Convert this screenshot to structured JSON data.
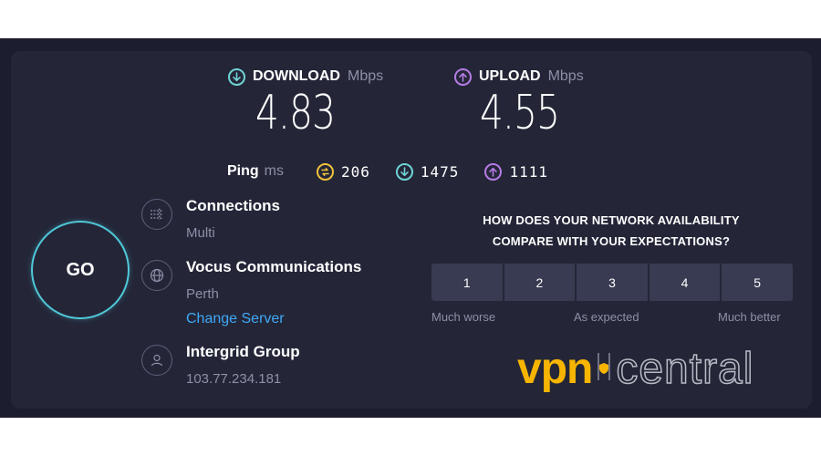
{
  "download": {
    "label": "DOWNLOAD",
    "unit": "Mbps",
    "value": "4.83",
    "icon": "arrow-down-circle-icon"
  },
  "upload": {
    "label": "UPLOAD",
    "unit": "Mbps",
    "value": "4.55",
    "icon": "arrow-up-circle-icon"
  },
  "ping": {
    "label": "Ping",
    "unit": "ms",
    "idle": "206",
    "download": "1475",
    "upload": "1111"
  },
  "go_label": "GO",
  "connections": {
    "title": "Connections",
    "value": "Multi"
  },
  "server": {
    "title": "Vocus Communications",
    "location": "Perth",
    "change_link": "Change Server"
  },
  "provider": {
    "title": "Intergrid Group",
    "ip": "103.77.234.181"
  },
  "survey": {
    "question_line1": "HOW DOES YOUR NETWORK AVAILABILITY",
    "question_line2": "COMPARE WITH YOUR EXPECTATIONS?",
    "options": [
      "1",
      "2",
      "3",
      "4",
      "5"
    ],
    "label_low": "Much worse",
    "label_mid": "As expected",
    "label_high": "Much better"
  },
  "watermark": {
    "part1": "vpn",
    "part2": "central"
  },
  "colors": {
    "background": "#242638",
    "download_accent": "#6fd4d4",
    "upload_accent": "#b57ce5",
    "ping_accent": "#f0c23a",
    "go_ring": "#4fc9d9",
    "link": "#3fa9f5",
    "rating_button": "#383b51",
    "watermark_brand": "#f7b500"
  }
}
